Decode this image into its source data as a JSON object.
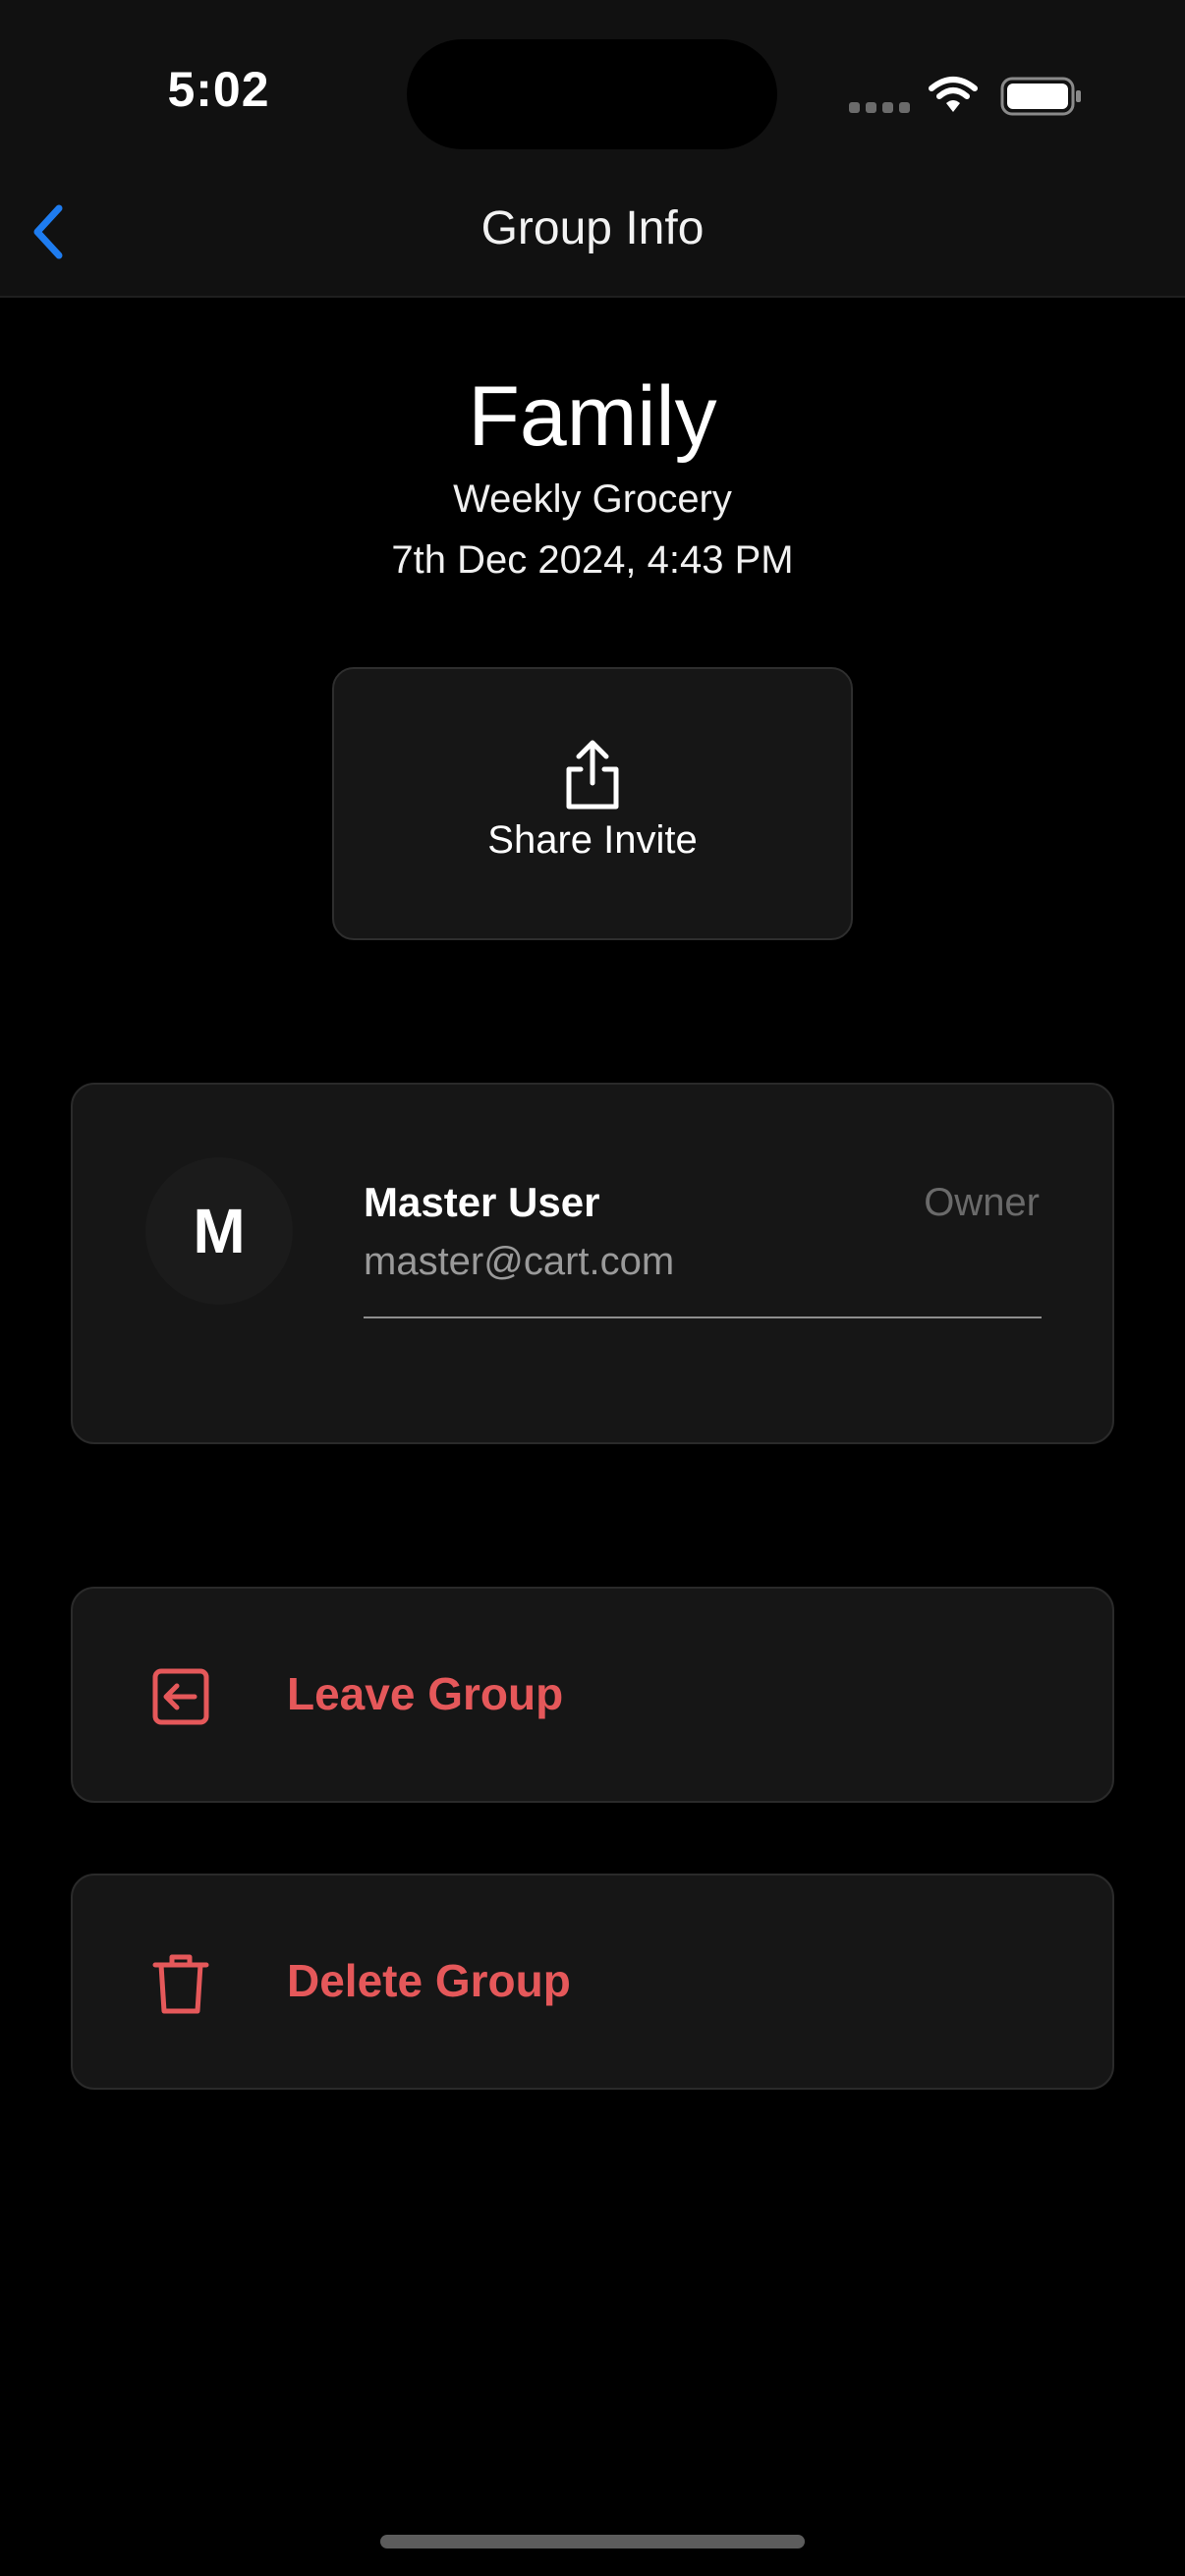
{
  "status_bar": {
    "time": "5:02"
  },
  "nav": {
    "title": "Group Info",
    "back_icon": "chevron-left-icon"
  },
  "group": {
    "name": "Family",
    "subtitle": "Weekly Grocery",
    "date": "7th Dec 2024, 4:43 PM"
  },
  "share": {
    "label": "Share Invite",
    "icon": "share-icon"
  },
  "members": [
    {
      "initial": "M",
      "name": "Master User",
      "email": "master@cart.com",
      "role": "Owner"
    }
  ],
  "actions": {
    "leave": {
      "label": "Leave Group",
      "icon": "leave-icon"
    },
    "delete": {
      "label": "Delete Group",
      "icon": "trash-icon"
    }
  },
  "colors": {
    "background": "#000000",
    "card": "#161616",
    "accent_blue": "#1e7cf0",
    "destructive": "#e5585a"
  }
}
